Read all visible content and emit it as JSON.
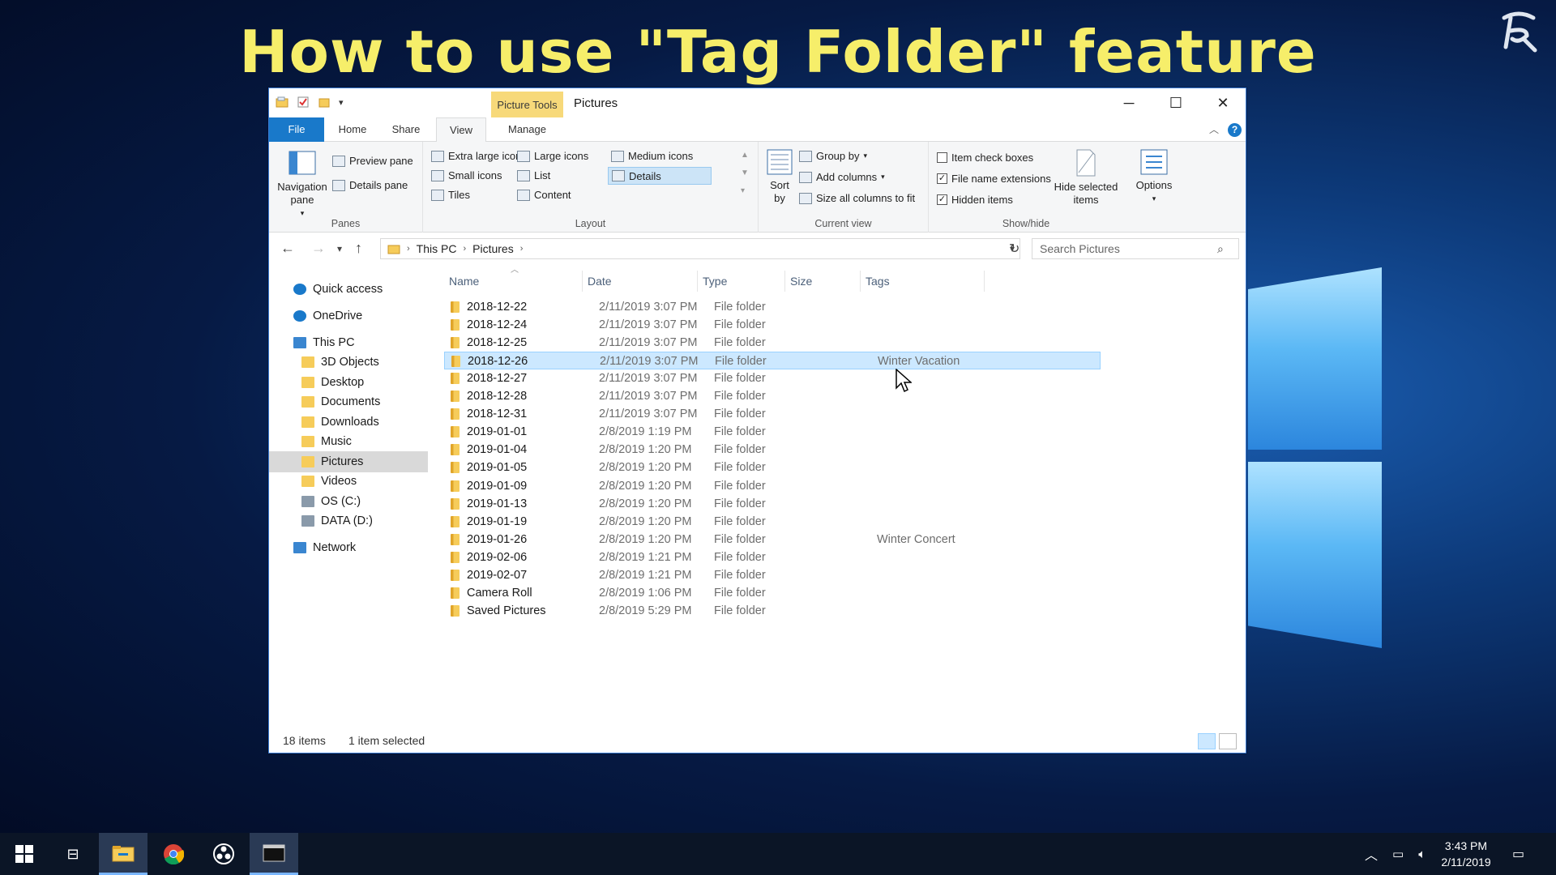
{
  "overlay": {
    "headline": "How to use \"Tag Folder\" feature"
  },
  "window": {
    "contextual_tab": "Picture Tools",
    "title": "Pictures",
    "controls": {
      "minimize": "─",
      "maximize": "☐",
      "close": "✕"
    },
    "tabs": {
      "file": "File",
      "home": "Home",
      "share": "Share",
      "view": "View",
      "manage": "Manage"
    }
  },
  "ribbon": {
    "panes": {
      "label": "Panes",
      "navigation_pane": "Navigation\npane",
      "preview_pane": "Preview pane",
      "details_pane": "Details pane"
    },
    "layout": {
      "label": "Layout",
      "items": [
        "Extra large icons",
        "Large icons",
        "Medium icons",
        "Small icons",
        "List",
        "Details",
        "Tiles",
        "Content"
      ],
      "selected": "Details"
    },
    "current_view": {
      "label": "Current view",
      "sort_by": "Sort\nby",
      "group_by": "Group by",
      "add_columns": "Add columns",
      "size_all_columns": "Size all columns to fit"
    },
    "show_hide": {
      "label": "Show/hide",
      "item_check_boxes": {
        "text": "Item check boxes",
        "checked": false
      },
      "file_name_extensions": {
        "text": "File name extensions",
        "checked": true
      },
      "hidden_items": {
        "text": "Hidden items",
        "checked": true
      },
      "hide_selected": "Hide selected\nitems",
      "options": "Options"
    }
  },
  "address": {
    "crumbs": [
      "This PC",
      "Pictures"
    ],
    "search_placeholder": "Search Pictures"
  },
  "nav_pane": [
    {
      "label": "Quick access",
      "icon": "star-icon",
      "indent": 0
    },
    {
      "label": "OneDrive",
      "icon": "cloud-icon",
      "indent": 0
    },
    {
      "label": "This PC",
      "icon": "computer-icon",
      "indent": 0
    },
    {
      "label": "3D Objects",
      "icon": "cube-folder-icon",
      "indent": 1
    },
    {
      "label": "Desktop",
      "icon": "desktop-folder-icon",
      "indent": 1
    },
    {
      "label": "Documents",
      "icon": "documents-folder-icon",
      "indent": 1
    },
    {
      "label": "Downloads",
      "icon": "downloads-folder-icon",
      "indent": 1
    },
    {
      "label": "Music",
      "icon": "music-folder-icon",
      "indent": 1
    },
    {
      "label": "Pictures",
      "icon": "pictures-folder-icon",
      "indent": 1,
      "selected": true
    },
    {
      "label": "Videos",
      "icon": "videos-folder-icon",
      "indent": 1
    },
    {
      "label": "OS (C:)",
      "icon": "drive-icon",
      "indent": 1
    },
    {
      "label": "DATA (D:)",
      "icon": "drive-icon",
      "indent": 1
    },
    {
      "label": "Network",
      "icon": "network-icon",
      "indent": 0
    }
  ],
  "columns": {
    "name": "Name",
    "date": "Date",
    "type": "Type",
    "size": "Size",
    "tags": "Tags"
  },
  "files": [
    {
      "name": "2018-12-22",
      "date": "2/11/2019 3:07 PM",
      "type": "File folder",
      "tags": ""
    },
    {
      "name": "2018-12-24",
      "date": "2/11/2019 3:07 PM",
      "type": "File folder",
      "tags": ""
    },
    {
      "name": "2018-12-25",
      "date": "2/11/2019 3:07 PM",
      "type": "File folder",
      "tags": ""
    },
    {
      "name": "2018-12-26",
      "date": "2/11/2019 3:07 PM",
      "type": "File folder",
      "tags": "Winter Vacation",
      "selected": true
    },
    {
      "name": "2018-12-27",
      "date": "2/11/2019 3:07 PM",
      "type": "File folder",
      "tags": ""
    },
    {
      "name": "2018-12-28",
      "date": "2/11/2019 3:07 PM",
      "type": "File folder",
      "tags": ""
    },
    {
      "name": "2018-12-31",
      "date": "2/11/2019 3:07 PM",
      "type": "File folder",
      "tags": ""
    },
    {
      "name": "2019-01-01",
      "date": "2/8/2019 1:19 PM",
      "type": "File folder",
      "tags": ""
    },
    {
      "name": "2019-01-04",
      "date": "2/8/2019 1:20 PM",
      "type": "File folder",
      "tags": ""
    },
    {
      "name": "2019-01-05",
      "date": "2/8/2019 1:20 PM",
      "type": "File folder",
      "tags": ""
    },
    {
      "name": "2019-01-09",
      "date": "2/8/2019 1:20 PM",
      "type": "File folder",
      "tags": ""
    },
    {
      "name": "2019-01-13",
      "date": "2/8/2019 1:20 PM",
      "type": "File folder",
      "tags": ""
    },
    {
      "name": "2019-01-19",
      "date": "2/8/2019 1:20 PM",
      "type": "File folder",
      "tags": ""
    },
    {
      "name": "2019-01-26",
      "date": "2/8/2019 1:20 PM",
      "type": "File folder",
      "tags": "Winter Concert"
    },
    {
      "name": "2019-02-06",
      "date": "2/8/2019 1:21 PM",
      "type": "File folder",
      "tags": ""
    },
    {
      "name": "2019-02-07",
      "date": "2/8/2019 1:21 PM",
      "type": "File folder",
      "tags": ""
    },
    {
      "name": "Camera Roll",
      "date": "2/8/2019 1:06 PM",
      "type": "File folder",
      "tags": ""
    },
    {
      "name": "Saved Pictures",
      "date": "2/8/2019 5:29 PM",
      "type": "File folder",
      "tags": ""
    }
  ],
  "status": {
    "count": "18 items",
    "selection": "1 item selected"
  },
  "taskbar": {
    "time": "3:43 PM",
    "date": "2/11/2019"
  },
  "colors": {
    "accent": "#1979ca",
    "selection": "#cce8ff",
    "headline": "#f6ee6a",
    "picture_tools": "#f7d97a"
  }
}
